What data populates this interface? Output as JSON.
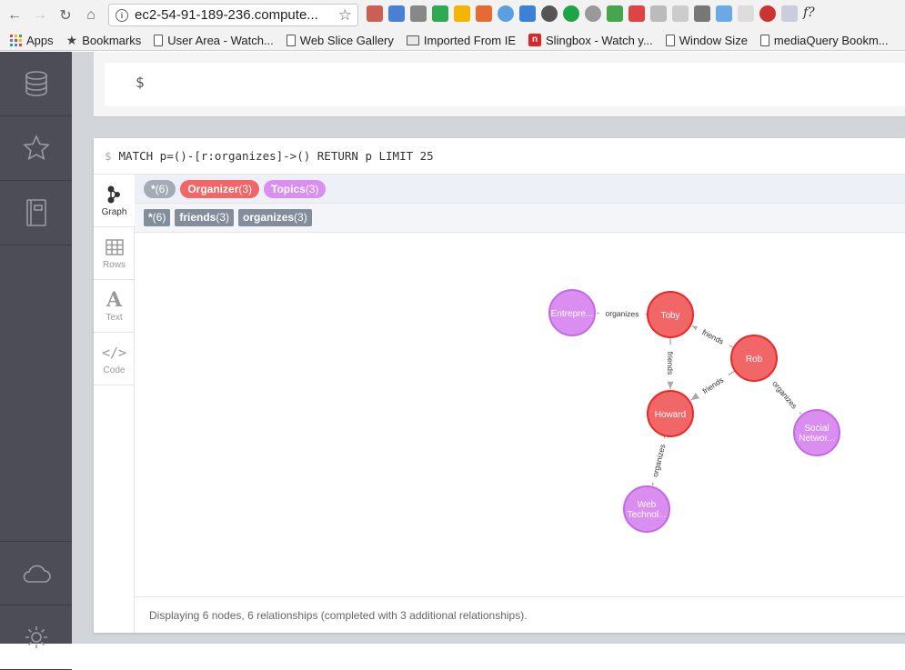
{
  "browser": {
    "url": "ec2-54-91-189-236.compute...",
    "bookmarks": [
      {
        "label": "Apps",
        "icon": "apps-grid-icon"
      },
      {
        "label": "Bookmarks",
        "icon": "star-icon"
      },
      {
        "label": "User Area - Watch...",
        "icon": "page-icon"
      },
      {
        "label": "Web Slice Gallery",
        "icon": "page-icon"
      },
      {
        "label": "Imported From IE",
        "icon": "folder-icon"
      },
      {
        "label": "Slingbox - Watch y...",
        "icon": "slingbox-icon"
      },
      {
        "label": "Window Size",
        "icon": "page-icon"
      },
      {
        "label": "mediaQuery Bookm...",
        "icon": "page-icon"
      }
    ]
  },
  "sidebar": {
    "items": [
      "database-icon",
      "star-icon",
      "book-icon"
    ],
    "bottom": [
      "cloud-icon",
      "settings-icon"
    ]
  },
  "editor": {
    "prompt": "$"
  },
  "result": {
    "prompt": "$",
    "query": "MATCH p=()-[r:organizes]->() RETURN p LIMIT 25",
    "tabs": [
      {
        "label": "Graph",
        "icon": "graph-icon"
      },
      {
        "label": "Rows",
        "icon": "table-icon"
      },
      {
        "label": "Text",
        "icon": "text-icon",
        "glyph": "A"
      },
      {
        "label": "Code",
        "icon": "code-icon",
        "glyph": "</>"
      }
    ],
    "node_labels": [
      {
        "name": "*",
        "count": "(6)",
        "color": "#a5abb6"
      },
      {
        "name": "Organizer",
        "count": "(3)",
        "color": "#f16667"
      },
      {
        "name": "Topics",
        "count": "(3)",
        "color": "#d98ef0"
      }
    ],
    "rel_types": [
      {
        "name": "*",
        "count": "(6)"
      },
      {
        "name": "friends",
        "count": "(3)"
      },
      {
        "name": "organizes",
        "count": "(3)"
      }
    ],
    "graph": {
      "nodes": [
        {
          "id": "entrepre",
          "label": "Entrepre...",
          "type": "Topics"
        },
        {
          "id": "toby",
          "label": "Toby",
          "type": "Organizer"
        },
        {
          "id": "rob",
          "label": "Rob",
          "type": "Organizer"
        },
        {
          "id": "howard",
          "label": "Howard",
          "type": "Organizer"
        },
        {
          "id": "social",
          "label": "Social Networ...",
          "type": "Topics"
        },
        {
          "id": "web",
          "label": "Web Technol...",
          "type": "Topics"
        }
      ],
      "relationships": [
        {
          "from": "toby",
          "to": "entrepre",
          "type": "organizes"
        },
        {
          "from": "rob",
          "to": "toby",
          "type": "friends"
        },
        {
          "from": "toby",
          "to": "howard",
          "type": "friends"
        },
        {
          "from": "rob",
          "to": "howard",
          "type": "friends"
        },
        {
          "from": "rob",
          "to": "social",
          "type": "organizes"
        },
        {
          "from": "howard",
          "to": "web",
          "type": "organizes"
        }
      ]
    },
    "status": "Displaying 6 nodes, 6 relationships (completed with 3 additional relationships)."
  },
  "colors": {
    "organizer": "#f16667",
    "organizer_stroke": "#eb2728",
    "topics": "#d98ef0",
    "topics_stroke": "#c569e3",
    "rel_pill": "#848d9b",
    "edge": "#aaaaaa"
  }
}
